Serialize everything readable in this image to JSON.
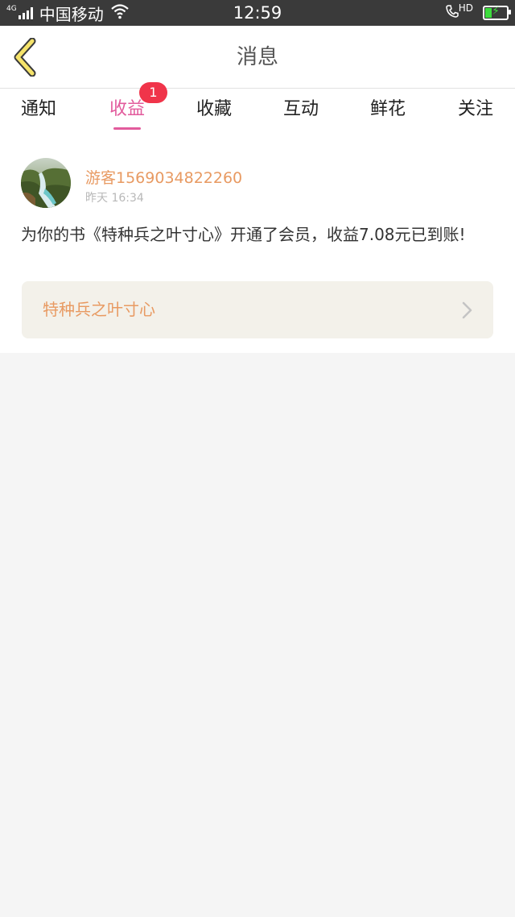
{
  "status_bar": {
    "network": "4G",
    "carrier": "中国移动",
    "time": "12:59",
    "hd_label": "HD",
    "battery_level": 0.35
  },
  "header": {
    "title": "消息",
    "back_icon": "back-chevron-icon"
  },
  "tabs": [
    {
      "label": "通知",
      "active": false
    },
    {
      "label": "收益",
      "active": true,
      "badge": "1"
    },
    {
      "label": "收藏",
      "active": false
    },
    {
      "label": "互动",
      "active": false
    },
    {
      "label": "鲜花",
      "active": false
    },
    {
      "label": "关注",
      "active": false
    }
  ],
  "message": {
    "username": "游客1569034822260",
    "timestamp": "昨天 16:34",
    "body": "为你的书《特种兵之叶寸心》开通了会员，收益7.08元已到账!",
    "book_title": "特种兵之叶寸心"
  },
  "colors": {
    "accent": "#e25b9c",
    "badge": "#f0344a",
    "username": "#e89a62",
    "status_bar": "#3a3a3a"
  }
}
